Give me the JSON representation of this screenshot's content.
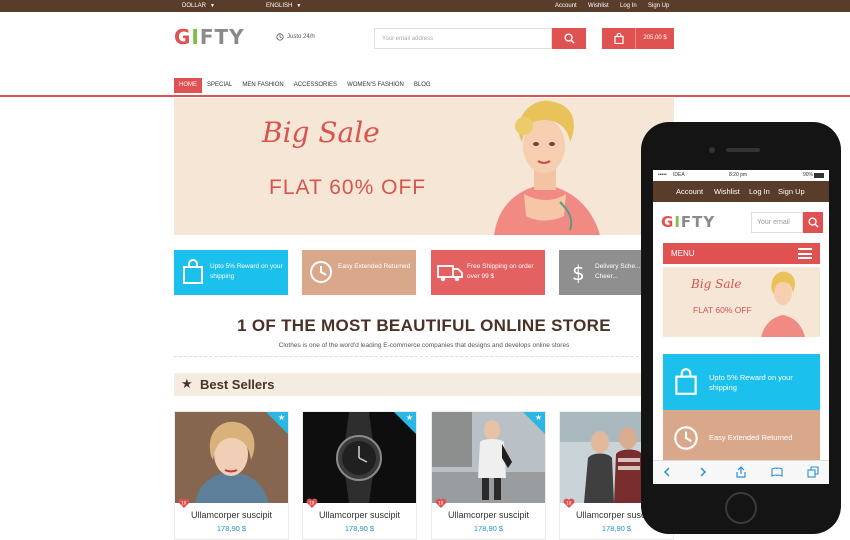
{
  "topbar": {
    "currency": "DOLLAR",
    "language": "ENGLISH",
    "links": [
      "Account",
      "Wishlist",
      "Log In",
      "Sign Up"
    ]
  },
  "header": {
    "logo": "GIFTY",
    "hours": "Justo 24/h",
    "search_placeholder": "Your email address",
    "cart_total": "205,00 $"
  },
  "nav": {
    "items": [
      "HOME",
      "SPECIAL",
      "MEN FASHION",
      "ACCESSORIES",
      "WOMEN'S FASHION",
      "BLOG"
    ],
    "active": "HOME"
  },
  "banner": {
    "headline": "Big Sale",
    "offer": "FLAT 60% OFF"
  },
  "features": [
    {
      "text": "Upto 5% Reward on your shipping",
      "color": "#1cc0ec",
      "icon": "shopping-bag-icon"
    },
    {
      "text": "Easy Extended Returned",
      "color": "#d9a88a",
      "icon": "clock-icon"
    },
    {
      "text": "Free Shipping on order over 99 $",
      "color": "#e46162",
      "icon": "truck-icon"
    },
    {
      "text": "Delivery Sche... Spread Cheer...",
      "color": "#8f8f8f",
      "icon": "dollar-icon"
    }
  ],
  "intro": {
    "title": "1 OF THE MOST BEAUTIFUL ONLINE STORE",
    "subtitle": "Clothes is one of the word'd leading E-commerce companies that designs and develops online stores"
  },
  "best_sellers": {
    "title": "Best Sellers",
    "products": [
      {
        "name": "Ullamcorper suscipit",
        "price": "178,90 $",
        "badge": "10"
      },
      {
        "name": "Ullamcorper suscipit",
        "price": "178,90 $",
        "badge": "10"
      },
      {
        "name": "Ullamcorper suscipit",
        "price": "178,90 $",
        "badge": "10"
      },
      {
        "name": "Ullamcorper suscipit",
        "price": "178,90 $",
        "badge": "10"
      }
    ]
  },
  "mobile": {
    "status": {
      "carrier": "IDEA",
      "time": "8:20 pm",
      "battery": "90%"
    },
    "top_links": [
      "Account",
      "Wishlist",
      "Log In",
      "Sign Up"
    ],
    "logo": "GIFTY",
    "search_placeholder": "Your email",
    "menu_label": "MENU",
    "banner_headline": "Big Sale",
    "banner_offer": "FLAT 60% OFF",
    "feature_1": "Upto 5% Reward on your shipping",
    "feature_2": "Easy Extended Returned"
  },
  "colors": {
    "brand_red": "#e05151",
    "topbar_brown": "#5a3c2a",
    "price_blue": "#2b8fd6",
    "corner_blue": "#2bb7e6"
  }
}
